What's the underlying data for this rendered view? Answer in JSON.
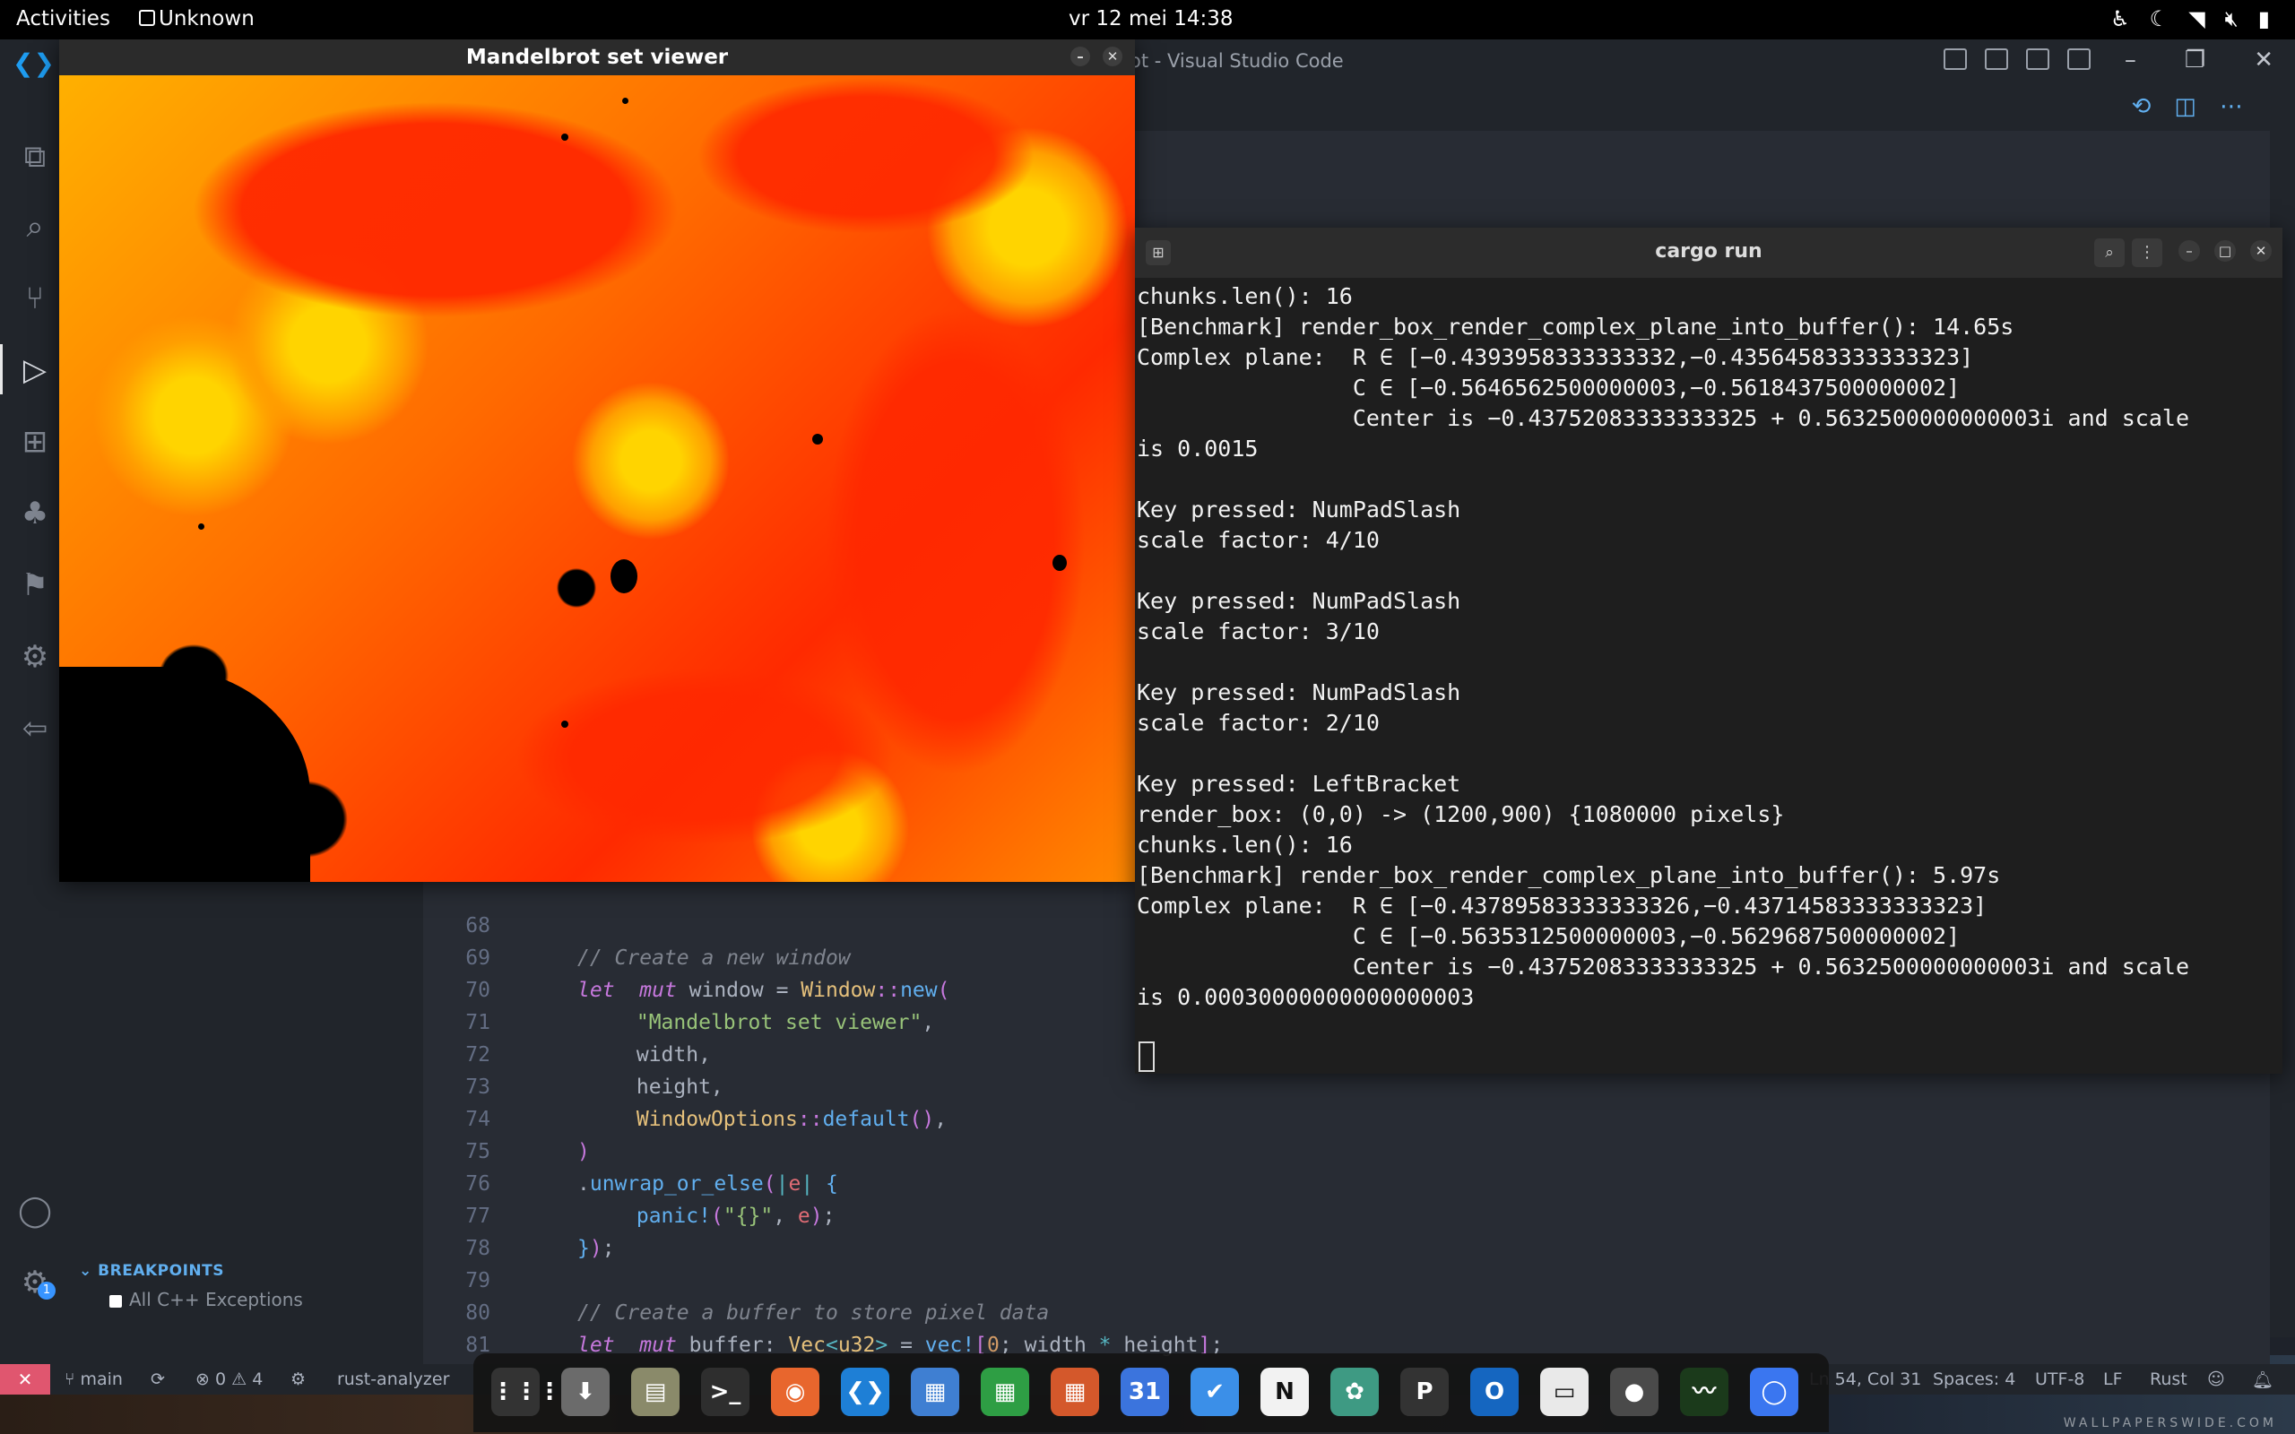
{
  "topbar": {
    "activities": "Activities",
    "app_name": "Unknown",
    "clock": "vr 12 mei  14:38",
    "tray_icons": [
      "accessibility-icon",
      "night-light-icon",
      "wifi-icon",
      "speaker-muted-icon",
      "battery-icon"
    ]
  },
  "vscode": {
    "title": "ot - Visual Studio Code",
    "breakpoints_header": "BREAKPOINTS",
    "breakpoint_item": "All C++ Exceptions",
    "settings_badge": "1",
    "code": [
      {
        "n": "68",
        "tokens": []
      },
      {
        "n": "69",
        "tokens": [
          [
            "cm",
            "// Create a new window"
          ]
        ]
      },
      {
        "n": "70",
        "tokens": [
          [
            "kw",
            "let"
          ],
          [
            "",
            "  "
          ],
          [
            "kw",
            "mut"
          ],
          [
            "",
            " window = "
          ],
          [
            "ty",
            "Window"
          ],
          [
            "pu",
            "::"
          ],
          [
            "fn",
            "new"
          ],
          [
            "pu",
            "("
          ]
        ]
      },
      {
        "n": "71",
        "tokens": [
          [
            "",
            " "
          ],
          [
            "st",
            "\"Mandelbrot set viewer\""
          ],
          [
            "",
            ","
          ]
        ]
      },
      {
        "n": "72",
        "tokens": [
          [
            "",
            " width,"
          ]
        ]
      },
      {
        "n": "73",
        "tokens": [
          [
            "",
            " height,"
          ]
        ]
      },
      {
        "n": "74",
        "tokens": [
          [
            "",
            " "
          ],
          [
            "ty",
            "WindowOptions"
          ],
          [
            "pu",
            "::"
          ],
          [
            "fn",
            "default"
          ],
          [
            "pu",
            "()"
          ],
          [
            "",
            ","
          ]
        ]
      },
      {
        "n": "75",
        "tokens": [
          [
            "pu",
            ")"
          ]
        ]
      },
      {
        "n": "76",
        "tokens": [
          [
            "",
            "."
          ],
          [
            "fn",
            "unwrap_or_else"
          ],
          [
            "pu",
            "("
          ],
          [
            "mc",
            "|"
          ],
          [
            "var",
            "e"
          ],
          [
            "mc",
            "|"
          ],
          [
            "",
            " "
          ],
          [
            "fn",
            "{"
          ]
        ]
      },
      {
        "n": "77",
        "tokens": [
          [
            "",
            " "
          ],
          [
            "fn",
            "panic!"
          ],
          [
            "pu",
            "("
          ],
          [
            "st",
            "\"{}\""
          ],
          [
            "",
            ", "
          ],
          [
            "var",
            "e"
          ],
          [
            "pu",
            ")"
          ],
          [
            "",
            ";"
          ]
        ]
      },
      {
        "n": "78",
        "tokens": [
          [
            "fn",
            "}"
          ],
          [
            "pu",
            ")"
          ],
          [
            "",
            ";"
          ]
        ]
      },
      {
        "n": "79",
        "tokens": []
      },
      {
        "n": "80",
        "tokens": [
          [
            "cm",
            "// Create a buffer to store pixel data"
          ]
        ]
      },
      {
        "n": "81",
        "tokens": [
          [
            "kw",
            "let"
          ],
          [
            "",
            "  "
          ],
          [
            "kw",
            "mut"
          ],
          [
            "",
            " buffer: "
          ],
          [
            "ty",
            "Vec"
          ],
          [
            "mc",
            "<"
          ],
          [
            "ty",
            "u32"
          ],
          [
            "mc",
            ">"
          ],
          [
            "",
            " = "
          ],
          [
            "fn",
            "vec!"
          ],
          [
            "pu",
            "["
          ],
          [
            "nu",
            "0"
          ],
          [
            "",
            "; width "
          ],
          [
            "mc",
            "*"
          ],
          [
            "",
            " height"
          ],
          [
            "pu",
            "]"
          ],
          [
            "",
            ";"
          ]
        ]
      }
    ]
  },
  "statusbar": {
    "branch": "main",
    "errors": "0",
    "warnings": "4",
    "language_server": "rust-analyzer",
    "cursor_pos": "Ln 54, Col 31",
    "indent": "Spaces: 4",
    "encoding": "UTF-8",
    "eol": "LF",
    "language": "Rust"
  },
  "mandelbrot_window": {
    "title": "Mandelbrot set viewer",
    "palette": [
      "#000000",
      "#00c800",
      "#e6e600",
      "#ffb000",
      "#ff2a00"
    ]
  },
  "terminal": {
    "title": "cargo run",
    "lines": [
      "chunks.len(): 16",
      "[Benchmark] render_box_render_complex_plane_into_buffer(): 14.65s",
      "Complex plane:  R ∈ [−0.4393958333333332,−0.43564583333333323]",
      "                C ∈ [−0.5646562500000003,−0.5618437500000002]",
      "                Center is −0.43752083333333325 + 0.5632500000000003i and scale",
      "is 0.0015",
      "",
      "Key pressed: NumPadSlash",
      "scale factor: 4/10",
      "",
      "Key pressed: NumPadSlash",
      "scale factor: 3/10",
      "",
      "Key pressed: NumPadSlash",
      "scale factor: 2/10",
      "",
      "Key pressed: LeftBracket",
      "render_box: (0,0) -> (1200,900) {1080000 pixels}",
      "chunks.len(): 16",
      "[Benchmark] render_box_render_complex_plane_into_buffer(): 5.97s",
      "Complex plane:  R ∈ [−0.43789583333333326,−0.43714583333333323]",
      "                C ∈ [−0.5635312500000003,−0.5629687500000002]",
      "                Center is −0.43752083333333325 + 0.5632500000000003i and scale",
      "is 0.00030000000000000003"
    ]
  },
  "dock": {
    "apps": [
      {
        "name": "show-apps",
        "glyph": "⋮⋮⋮",
        "color": "#333333"
      },
      {
        "name": "software-center",
        "glyph": "⬇",
        "color": "#6b6b6b"
      },
      {
        "name": "files",
        "glyph": "▤",
        "color": "#8a8a6a"
      },
      {
        "name": "terminal",
        "glyph": ">_",
        "color": "#2e2e2e"
      },
      {
        "name": "firefox",
        "glyph": "◉",
        "color": "#e8662d"
      },
      {
        "name": "vscode",
        "glyph": "❮❯",
        "color": "#1e7fd6"
      },
      {
        "name": "writer",
        "glyph": "▦",
        "color": "#3f7fd2"
      },
      {
        "name": "calc",
        "glyph": "▦",
        "color": "#2e9e44"
      },
      {
        "name": "impress",
        "glyph": "▦",
        "color": "#d4582b"
      },
      {
        "name": "calendar",
        "glyph": "31",
        "color": "#3b74dd"
      },
      {
        "name": "tasks",
        "glyph": "✔",
        "color": "#3b8fe8"
      },
      {
        "name": "notion",
        "glyph": "N",
        "color": "#f2f2f2"
      },
      {
        "name": "chatgpt",
        "glyph": "✿",
        "color": "#3e9a83"
      },
      {
        "name": "pomodoro",
        "glyph": "P",
        "color": "#333333"
      },
      {
        "name": "outlook",
        "glyph": "O",
        "color": "#1566c0"
      },
      {
        "name": "notes",
        "glyph": "▭",
        "color": "#e9e9e9"
      },
      {
        "name": "screenshot",
        "glyph": "●",
        "color": "#4a4a4a"
      },
      {
        "name": "system-monitor",
        "glyph": "〰",
        "color": "#1b3a1b"
      },
      {
        "name": "signal",
        "glyph": "◯",
        "color": "#3a76f0"
      }
    ],
    "watermark": "WALLPAPERSWIDE.COM"
  }
}
